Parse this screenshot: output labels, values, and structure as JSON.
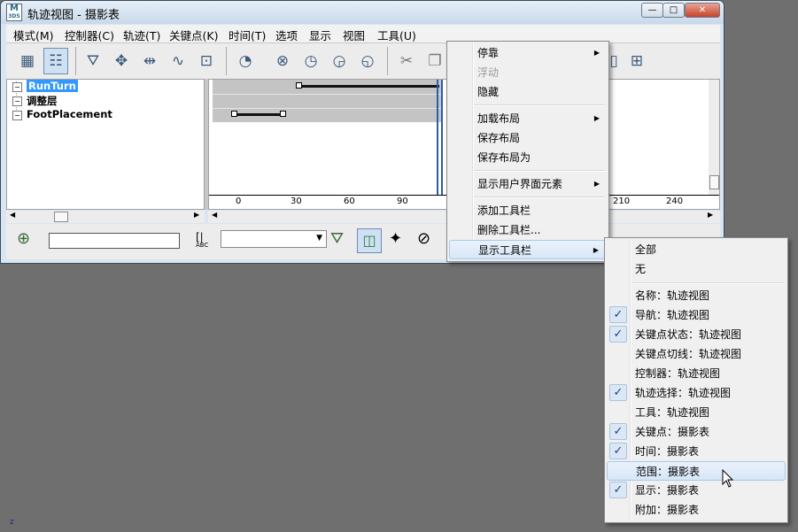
{
  "window": {
    "title": "轨迹视图 - 摄影表",
    "app_icon_text": "M",
    "app_icon_sub": "3DS",
    "buttons": {
      "minimize": "—",
      "maximize": "□",
      "close": "✕"
    }
  },
  "menubar": {
    "items": [
      "模式(M)",
      "控制器(C)",
      "轨迹(T)",
      "关键点(K)",
      "时间(T)",
      "选项",
      "显示",
      "视图",
      "工具(U)"
    ]
  },
  "tree": {
    "items": [
      "RunTurn",
      "调整层",
      "FootPlacement"
    ]
  },
  "timeline": {
    "ticks": [
      "0",
      "30",
      "60",
      "90",
      "210",
      "240"
    ]
  },
  "statusbar": {
    "field_value": "",
    "abc_label": "ABC"
  },
  "context_menu": {
    "items": [
      {
        "label": "停靠",
        "submenu": true,
        "disabled": false
      },
      {
        "label": "浮动",
        "submenu": false,
        "disabled": true
      },
      {
        "label": "隐藏",
        "submenu": false,
        "disabled": false
      },
      {
        "label": "加载布局",
        "submenu": true,
        "disabled": false
      },
      {
        "label": "保存布局",
        "submenu": false,
        "disabled": false
      },
      {
        "label": "保存布局为",
        "submenu": false,
        "disabled": false
      },
      {
        "label": "显示用户界面元素",
        "submenu": true,
        "disabled": false
      },
      {
        "label": "添加工具栏",
        "submenu": false,
        "disabled": false
      },
      {
        "label": "删除工具栏...",
        "submenu": false,
        "disabled": false
      },
      {
        "label": "显示工具栏",
        "submenu": true,
        "disabled": false
      }
    ]
  },
  "submenu": {
    "items": [
      {
        "label": "全部",
        "checked": false
      },
      {
        "label": "无",
        "checked": false
      },
      {
        "label": "名称：轨迹视图",
        "checked": false
      },
      {
        "label": "导航：轨迹视图",
        "checked": true
      },
      {
        "label": "关键点状态：轨迹视图",
        "checked": true
      },
      {
        "label": "关键点切线：轨迹视图",
        "checked": false
      },
      {
        "label": "控制器：轨迹视图",
        "checked": false
      },
      {
        "label": "轨迹选择：轨迹视图",
        "checked": true
      },
      {
        "label": "工具：轨迹视图",
        "checked": false
      },
      {
        "label": "关键点：摄影表",
        "checked": true
      },
      {
        "label": "时间：摄影表",
        "checked": true
      },
      {
        "label": "范围：摄影表",
        "checked": false
      },
      {
        "label": "显示：摄影表",
        "checked": true
      },
      {
        "label": "附加：摄影表",
        "checked": false
      }
    ]
  },
  "desktop": {
    "corner_label": "z"
  },
  "colors": {
    "desktop": "#6f6f6f",
    "selection": "#3399ff",
    "check_bg": "#dbe7f4"
  }
}
